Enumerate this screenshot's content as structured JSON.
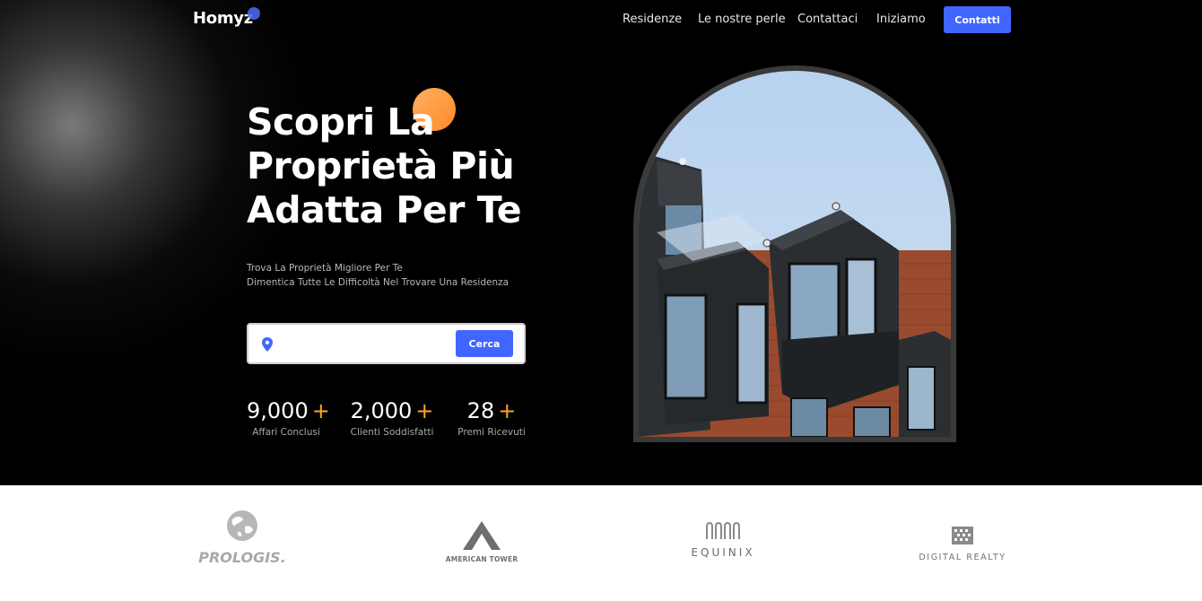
{
  "nav": {
    "logo": "Homyz",
    "links": [
      "Residenze",
      "Le nostre perle",
      "Contattaci",
      "Iniziamo"
    ],
    "cta": "Contatti"
  },
  "hero": {
    "headline_1": "Scopri La",
    "headline_2": "Proprietà Più",
    "headline_3": "Adatta Per Te",
    "sub_1": "Trova La Proprietà Migliore Per Te",
    "sub_2": "Dimentica Tutte Le Difficoltà Nel Trovare Una Residenza",
    "search": {
      "placeholder": "",
      "button": "Cerca"
    },
    "stats": [
      {
        "value": "9,000",
        "plus": "+",
        "label": "Affari Conclusi"
      },
      {
        "value": "2,000",
        "plus": "+",
        "label": "Clienti Soddisfatti"
      },
      {
        "value": "28",
        "plus": "+",
        "label": "Premi Ricevuti"
      }
    ]
  },
  "brands": [
    "PROLOGIS.",
    "AMERICAN TOWER",
    "EQUINIX",
    "DIGITAL REALTY"
  ],
  "colors": {
    "accent_blue": "#4066ff",
    "accent_orange": "#ffa51f",
    "hero_bg": "#000000"
  }
}
